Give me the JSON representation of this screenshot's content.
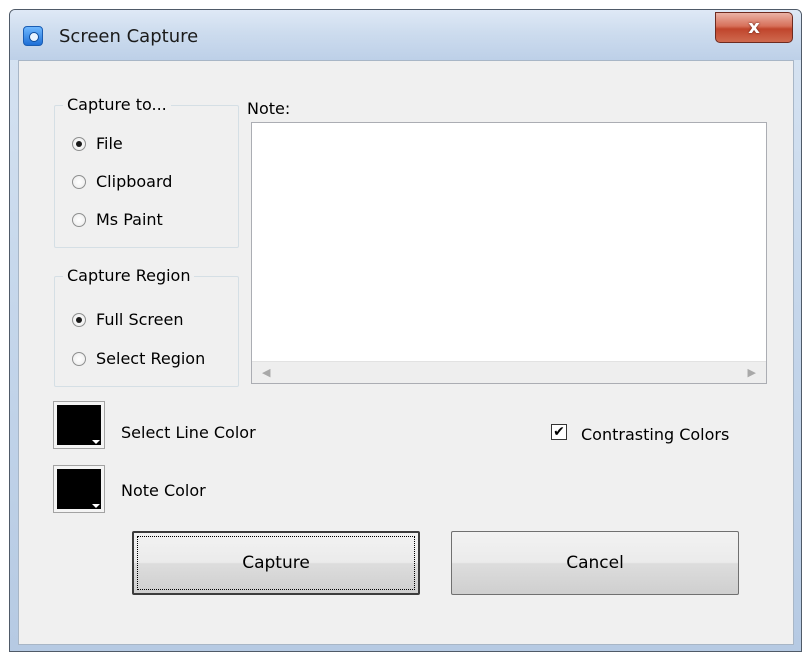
{
  "window": {
    "title": "Screen Capture",
    "close_glyph": "x"
  },
  "capture_to": {
    "legend": "Capture to...",
    "options": [
      {
        "label": "File",
        "checked": true
      },
      {
        "label": "Clipboard",
        "checked": false
      },
      {
        "label": "Ms Paint",
        "checked": false
      }
    ]
  },
  "capture_region": {
    "legend": "Capture Region",
    "options": [
      {
        "label": "Full Screen",
        "checked": true
      },
      {
        "label": "Select Region",
        "checked": false
      }
    ]
  },
  "note": {
    "label": "Note:",
    "value": ""
  },
  "colors": {
    "line_color_label": "Select Line Color",
    "note_color_label": "Note Color",
    "line_color": "#000000",
    "note_color": "#000000"
  },
  "contrasting": {
    "label": "Contrasting Colors",
    "checked": true,
    "check_glyph": "✔"
  },
  "buttons": {
    "capture": "Capture",
    "cancel": "Cancel"
  },
  "scrollbar": {
    "left_arrow": "◀",
    "right_arrow": "▶"
  }
}
